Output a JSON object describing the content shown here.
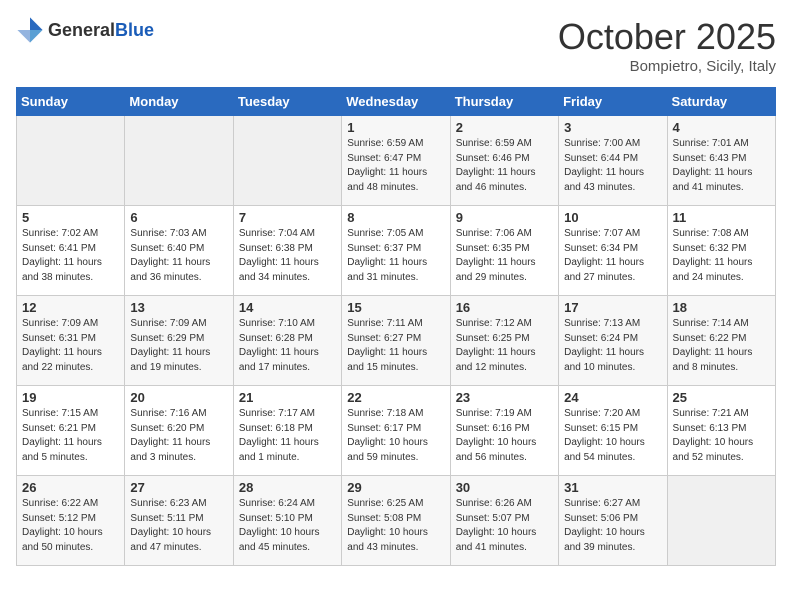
{
  "header": {
    "logo_general": "General",
    "logo_blue": "Blue",
    "month": "October 2025",
    "location": "Bompietro, Sicily, Italy"
  },
  "days_of_week": [
    "Sunday",
    "Monday",
    "Tuesday",
    "Wednesday",
    "Thursday",
    "Friday",
    "Saturday"
  ],
  "weeks": [
    [
      {
        "day": "",
        "info": ""
      },
      {
        "day": "",
        "info": ""
      },
      {
        "day": "",
        "info": ""
      },
      {
        "day": "1",
        "info": "Sunrise: 6:59 AM\nSunset: 6:47 PM\nDaylight: 11 hours\nand 48 minutes."
      },
      {
        "day": "2",
        "info": "Sunrise: 6:59 AM\nSunset: 6:46 PM\nDaylight: 11 hours\nand 46 minutes."
      },
      {
        "day": "3",
        "info": "Sunrise: 7:00 AM\nSunset: 6:44 PM\nDaylight: 11 hours\nand 43 minutes."
      },
      {
        "day": "4",
        "info": "Sunrise: 7:01 AM\nSunset: 6:43 PM\nDaylight: 11 hours\nand 41 minutes."
      }
    ],
    [
      {
        "day": "5",
        "info": "Sunrise: 7:02 AM\nSunset: 6:41 PM\nDaylight: 11 hours\nand 38 minutes."
      },
      {
        "day": "6",
        "info": "Sunrise: 7:03 AM\nSunset: 6:40 PM\nDaylight: 11 hours\nand 36 minutes."
      },
      {
        "day": "7",
        "info": "Sunrise: 7:04 AM\nSunset: 6:38 PM\nDaylight: 11 hours\nand 34 minutes."
      },
      {
        "day": "8",
        "info": "Sunrise: 7:05 AM\nSunset: 6:37 PM\nDaylight: 11 hours\nand 31 minutes."
      },
      {
        "day": "9",
        "info": "Sunrise: 7:06 AM\nSunset: 6:35 PM\nDaylight: 11 hours\nand 29 minutes."
      },
      {
        "day": "10",
        "info": "Sunrise: 7:07 AM\nSunset: 6:34 PM\nDaylight: 11 hours\nand 27 minutes."
      },
      {
        "day": "11",
        "info": "Sunrise: 7:08 AM\nSunset: 6:32 PM\nDaylight: 11 hours\nand 24 minutes."
      }
    ],
    [
      {
        "day": "12",
        "info": "Sunrise: 7:09 AM\nSunset: 6:31 PM\nDaylight: 11 hours\nand 22 minutes."
      },
      {
        "day": "13",
        "info": "Sunrise: 7:09 AM\nSunset: 6:29 PM\nDaylight: 11 hours\nand 19 minutes."
      },
      {
        "day": "14",
        "info": "Sunrise: 7:10 AM\nSunset: 6:28 PM\nDaylight: 11 hours\nand 17 minutes."
      },
      {
        "day": "15",
        "info": "Sunrise: 7:11 AM\nSunset: 6:27 PM\nDaylight: 11 hours\nand 15 minutes."
      },
      {
        "day": "16",
        "info": "Sunrise: 7:12 AM\nSunset: 6:25 PM\nDaylight: 11 hours\nand 12 minutes."
      },
      {
        "day": "17",
        "info": "Sunrise: 7:13 AM\nSunset: 6:24 PM\nDaylight: 11 hours\nand 10 minutes."
      },
      {
        "day": "18",
        "info": "Sunrise: 7:14 AM\nSunset: 6:22 PM\nDaylight: 11 hours\nand 8 minutes."
      }
    ],
    [
      {
        "day": "19",
        "info": "Sunrise: 7:15 AM\nSunset: 6:21 PM\nDaylight: 11 hours\nand 5 minutes."
      },
      {
        "day": "20",
        "info": "Sunrise: 7:16 AM\nSunset: 6:20 PM\nDaylight: 11 hours\nand 3 minutes."
      },
      {
        "day": "21",
        "info": "Sunrise: 7:17 AM\nSunset: 6:18 PM\nDaylight: 11 hours\nand 1 minute."
      },
      {
        "day": "22",
        "info": "Sunrise: 7:18 AM\nSunset: 6:17 PM\nDaylight: 10 hours\nand 59 minutes."
      },
      {
        "day": "23",
        "info": "Sunrise: 7:19 AM\nSunset: 6:16 PM\nDaylight: 10 hours\nand 56 minutes."
      },
      {
        "day": "24",
        "info": "Sunrise: 7:20 AM\nSunset: 6:15 PM\nDaylight: 10 hours\nand 54 minutes."
      },
      {
        "day": "25",
        "info": "Sunrise: 7:21 AM\nSunset: 6:13 PM\nDaylight: 10 hours\nand 52 minutes."
      }
    ],
    [
      {
        "day": "26",
        "info": "Sunrise: 6:22 AM\nSunset: 5:12 PM\nDaylight: 10 hours\nand 50 minutes."
      },
      {
        "day": "27",
        "info": "Sunrise: 6:23 AM\nSunset: 5:11 PM\nDaylight: 10 hours\nand 47 minutes."
      },
      {
        "day": "28",
        "info": "Sunrise: 6:24 AM\nSunset: 5:10 PM\nDaylight: 10 hours\nand 45 minutes."
      },
      {
        "day": "29",
        "info": "Sunrise: 6:25 AM\nSunset: 5:08 PM\nDaylight: 10 hours\nand 43 minutes."
      },
      {
        "day": "30",
        "info": "Sunrise: 6:26 AM\nSunset: 5:07 PM\nDaylight: 10 hours\nand 41 minutes."
      },
      {
        "day": "31",
        "info": "Sunrise: 6:27 AM\nSunset: 5:06 PM\nDaylight: 10 hours\nand 39 minutes."
      },
      {
        "day": "",
        "info": ""
      }
    ]
  ]
}
